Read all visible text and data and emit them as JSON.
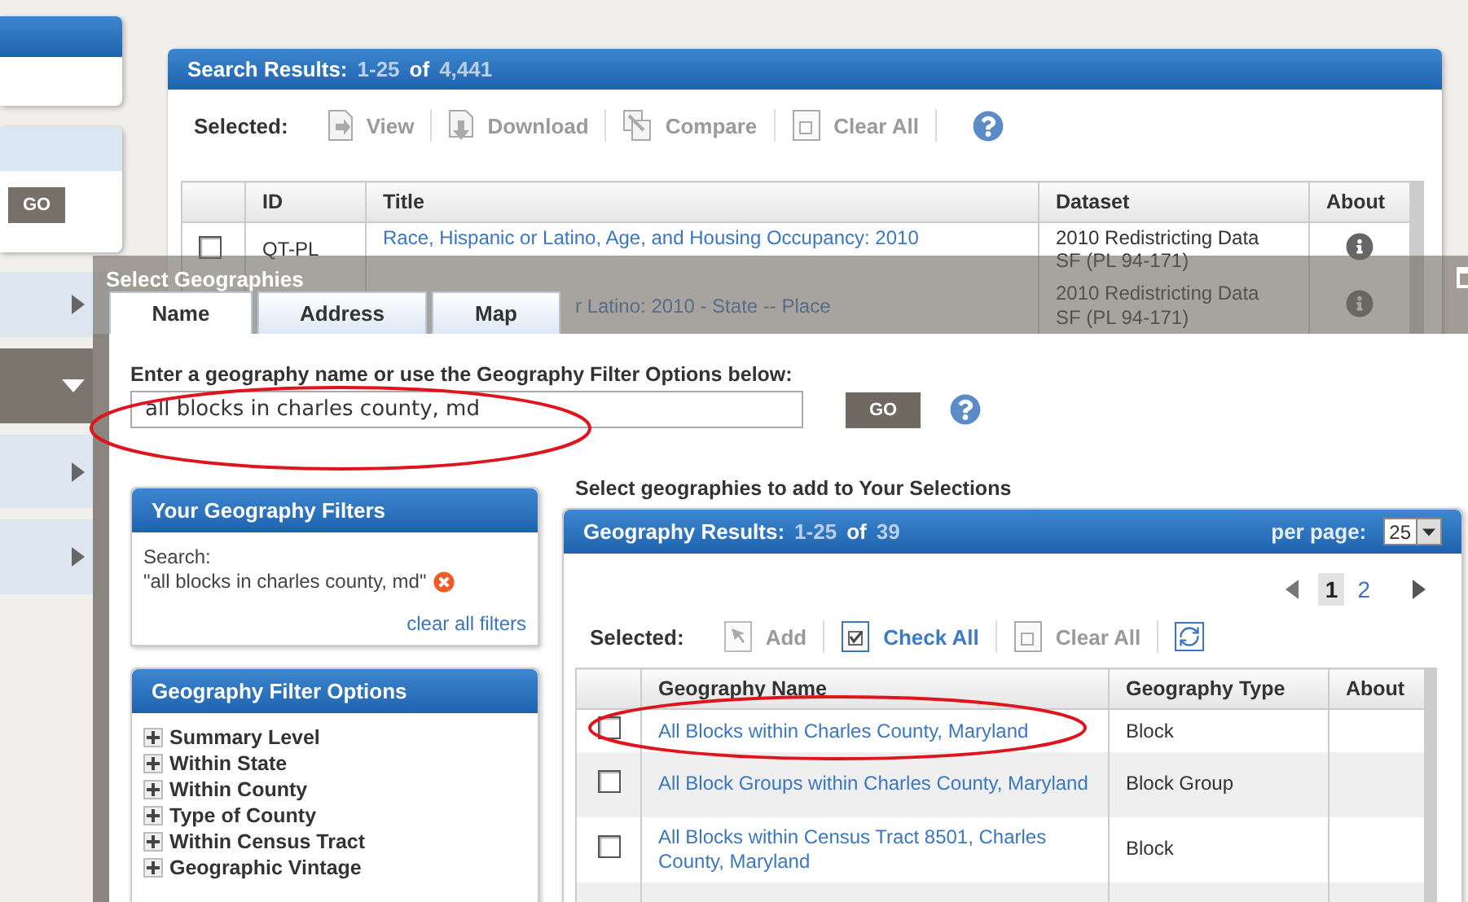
{
  "sidebar": {
    "go_button": "GO",
    "sections": [
      {
        "expanded": false
      },
      {
        "expanded": true
      },
      {
        "expanded": false
      },
      {
        "expanded": false
      }
    ]
  },
  "search_results": {
    "title": "Search Results:",
    "range": "1-25",
    "of": "of",
    "total": "4,441",
    "toolbar": {
      "label": "Selected:",
      "actions": [
        {
          "kind": "view",
          "label": "View",
          "disabled": true
        },
        {
          "kind": "download",
          "label": "Download",
          "disabled": true
        },
        {
          "kind": "compare",
          "label": "Compare",
          "disabled": true
        },
        {
          "kind": "clear",
          "label": "Clear All",
          "disabled": true
        },
        {
          "kind": "help"
        }
      ]
    },
    "columns": [
      "ID",
      "Title",
      "Dataset",
      "About"
    ],
    "rows": [
      {
        "checked": false,
        "id": "QT-PL",
        "title": "Race, Hispanic or Latino, Age, and Housing Occupancy: 2010",
        "dataset": "2010 Redistricting Data SF (PL 94-171)"
      },
      {
        "title": "r Latino: 2010 - State -- Place",
        "dataset": "2010 Redistricting Data SF (PL 94-171)"
      }
    ]
  },
  "dialog": {
    "title": "Select Geographies",
    "tabs": [
      {
        "label": "Name",
        "selected": true
      },
      {
        "label": "Address",
        "selected": false
      },
      {
        "label": "Map",
        "selected": false
      }
    ],
    "prompt": "Enter a geography name or use the Geography Filter Options below:",
    "search": {
      "value": "all blocks in charles county, md"
    },
    "go_button": "GO",
    "filters": {
      "title": "Your Geography Filters",
      "search_label": "Search:",
      "search_value": "\"all blocks in charles county, md\"",
      "clear_link": "clear all filters"
    },
    "filter_options": {
      "title": "Geography Filter Options",
      "items": [
        {
          "label": "Summary Level",
          "expanded": false
        },
        {
          "label": "Within State",
          "expanded": false
        },
        {
          "label": "Within County",
          "expanded": false
        },
        {
          "label": "Type of County",
          "expanded": false
        },
        {
          "label": "Within Census Tract",
          "expanded": false
        },
        {
          "label": "Geographic Vintage",
          "expanded": false
        }
      ]
    },
    "results_heading": "Select geographies to add to Your Selections",
    "results": {
      "title": "Geography Results:",
      "range": "1-25",
      "of": "of",
      "total": "39",
      "per_page_label": "per page:",
      "per_page": "25",
      "pages": [
        {
          "label": "1",
          "selected": true
        },
        {
          "label": "2",
          "selected": false
        }
      ],
      "toolbar": {
        "label": "Selected:",
        "actions": [
          {
            "kind": "add",
            "label": "Add",
            "disabled": true
          },
          {
            "kind": "check",
            "label": "Check All",
            "disabled": false
          },
          {
            "kind": "clear",
            "label": "Clear All",
            "disabled": true
          },
          {
            "kind": "refresh",
            "disabled": false
          }
        ]
      },
      "columns": [
        "Geography Name",
        "Geography Type",
        "About"
      ],
      "rows": [
        {
          "checked": false,
          "name": "All Blocks within Charles County, Maryland",
          "type": "Block"
        },
        {
          "checked": false,
          "name": "All Block Groups within Charles County, Maryland",
          "type": "Block Group"
        },
        {
          "checked": false,
          "name": "All Blocks within Census Tract 8501, Charles County, Maryland",
          "type": "Block"
        }
      ]
    }
  }
}
